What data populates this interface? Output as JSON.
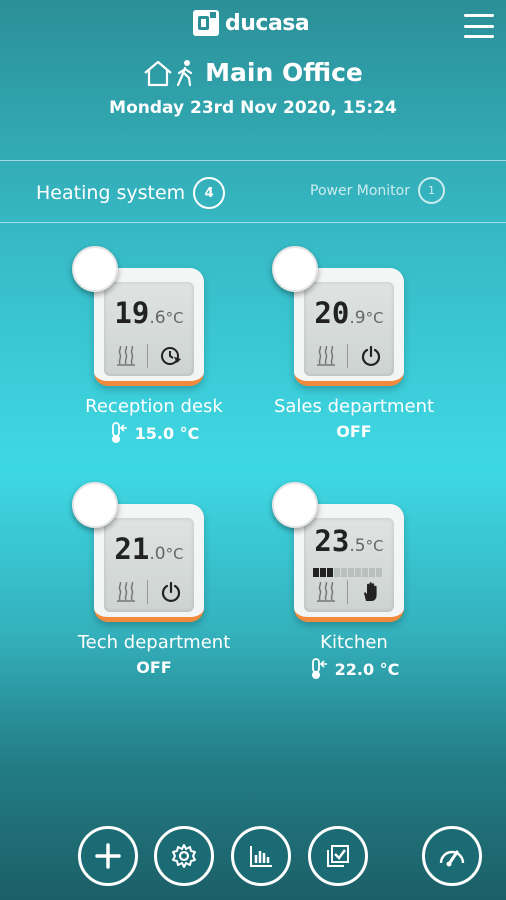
{
  "header": {
    "brand": "ducasa",
    "title": "Main Office",
    "datetime": "Monday 23rd Nov 2020, 15:24"
  },
  "tabs": [
    {
      "label": "Heating system",
      "count": "4"
    },
    {
      "label": "Power Monitor",
      "count": "1"
    }
  ],
  "devices": [
    {
      "name": "Reception desk",
      "temp_int": "19",
      "temp_dec": ".6",
      "unit": "°C",
      "status": "15.0 °C",
      "mode_icon": "schedule-icon"
    },
    {
      "name": "Sales department",
      "temp_int": "20",
      "temp_dec": ".9",
      "unit": "°C",
      "status": "OFF",
      "mode_icon": "power-icon"
    },
    {
      "name": "Tech department",
      "temp_int": "21",
      "temp_dec": ".0",
      "unit": "°C",
      "status": "OFF",
      "mode_icon": "power-icon"
    },
    {
      "name": "Kitchen",
      "temp_int": "23",
      "temp_dec": ".5",
      "unit": "°C",
      "status": "22.0 °C",
      "mode_icon": "hand-icon",
      "level_bars_on": 3,
      "level_bars_total": 10
    }
  ],
  "bottom_nav": [
    "add-icon",
    "settings-icon",
    "chart-icon",
    "checklist-icon",
    "gauge-icon"
  ],
  "colors": {
    "accent": "#f18a3c",
    "background_top": "#2b8f97",
    "background_mid": "#3ed8e4",
    "background_bottom": "#1c5f67"
  }
}
